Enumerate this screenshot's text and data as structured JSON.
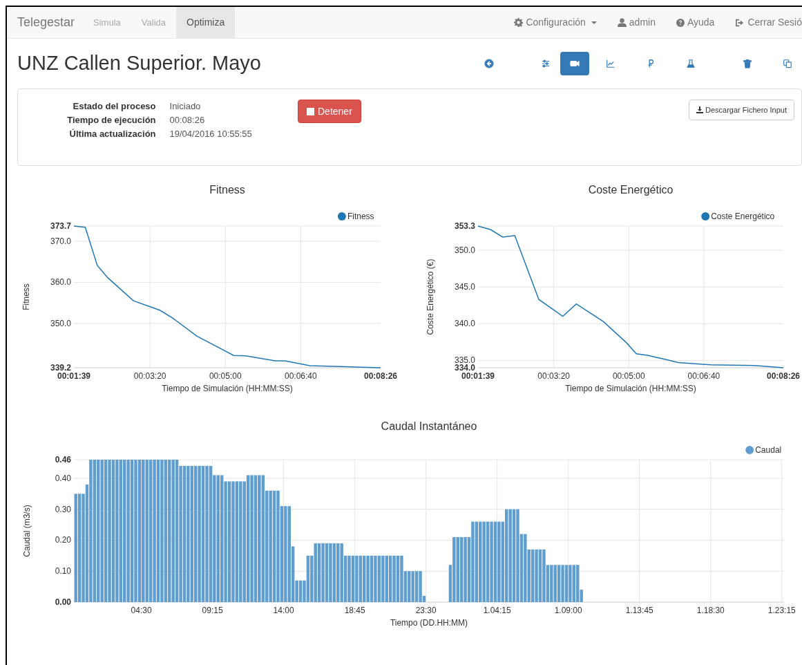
{
  "navbar": {
    "brand": "Telegestar",
    "tabs": [
      {
        "label": "Simula",
        "selected": false,
        "disabled": true
      },
      {
        "label": "Valida",
        "selected": false,
        "disabled": true
      },
      {
        "label": "Optimiza",
        "selected": true,
        "disabled": false
      }
    ],
    "menu": [
      {
        "kind": "gear",
        "label": "Configuración",
        "dropdown": true
      },
      {
        "kind": "user",
        "label": "admin",
        "dropdown": false
      },
      {
        "kind": "help",
        "label": "Ayuda",
        "dropdown": false
      },
      {
        "kind": "logout",
        "label": "Cerrar Sesió",
        "dropdown": false
      }
    ]
  },
  "page_title": "UNZ Callen Superior. Mayo",
  "toolbar": [
    {
      "kind": "back",
      "selected": false
    },
    {
      "kind": "sliders",
      "selected": false
    },
    {
      "kind": "camera",
      "selected": true
    },
    {
      "kind": "chart",
      "selected": false
    },
    {
      "kind": "currency",
      "selected": false
    },
    {
      "kind": "flask",
      "selected": false
    },
    {
      "kind": "trash",
      "selected": false
    },
    {
      "kind": "copy",
      "selected": false
    }
  ],
  "process_panel": {
    "fields": [
      {
        "label": "Estado del proceso",
        "value": "Iniciado"
      },
      {
        "label": "Tiempo de ejecución",
        "value": "00:08:26"
      },
      {
        "label": "Última actualización",
        "value": "19/04/2016 10:55:55"
      }
    ],
    "stop_button": "Detener",
    "download_button": "Descargar Fichero Input"
  },
  "fitness_chart": {
    "chart_data": {
      "type": "line",
      "grid": true,
      "title": "Fitness",
      "xlabel": "Tiempo de Simulación (HH:MM:SS)",
      "ylabel": "Fitness",
      "x": [
        99,
        114,
        130,
        144,
        178,
        213,
        230,
        262,
        311,
        327,
        366,
        379,
        412,
        506
      ],
      "series": [
        {
          "name": "Fitness",
          "color": "#1f77b4",
          "values": [
            373.7,
            373.4,
            364.1,
            361.1,
            355.5,
            353.2,
            351.3,
            346.9,
            342.2,
            342.1,
            340.9,
            340.9,
            339.7,
            339.2
          ]
        }
      ],
      "xlim": [
        99,
        506
      ],
      "ylim": [
        339.2,
        373.7
      ],
      "xticks": [
        {
          "value": 99,
          "label": "00:01:39"
        },
        {
          "value": 200,
          "label": "00:03:20"
        },
        {
          "value": 300,
          "label": "00:05:00"
        },
        {
          "value": 400,
          "label": "00:06:40"
        },
        {
          "value": 506,
          "label": "00:08:26"
        }
      ],
      "yticks": [
        {
          "value": 339.2,
          "label": "339.2"
        },
        {
          "value": 350,
          "label": "350.0"
        },
        {
          "value": 360,
          "label": "360.0"
        },
        {
          "value": 370,
          "label": "370.0"
        },
        {
          "value": 373.7,
          "label": "373.7"
        }
      ]
    }
  },
  "cost_chart": {
    "chart_data": {
      "type": "line",
      "grid": true,
      "title": "Coste Energético",
      "xlabel": "Tiempo de Simulación (HH:MM:SS)",
      "ylabel": "Coste Energético (€)",
      "x": [
        99,
        116,
        132,
        148,
        180,
        212,
        230,
        266,
        297,
        310,
        325,
        350,
        366,
        410,
        468,
        506
      ],
      "series": [
        {
          "name": "Coste Energético",
          "color": "#1f77b4",
          "values": [
            353.3,
            352.8,
            351.8,
            352.0,
            343.3,
            341.0,
            342.7,
            340.3,
            337.4,
            335.9,
            335.7,
            335.1,
            334.7,
            334.4,
            334.3,
            334.0
          ]
        }
      ],
      "xlim": [
        99,
        506
      ],
      "ylim": [
        334,
        353.3
      ],
      "xticks": [
        {
          "value": 99,
          "label": "00:01:39"
        },
        {
          "value": 200,
          "label": "00:03:20"
        },
        {
          "value": 300,
          "label": "00:05:00"
        },
        {
          "value": 400,
          "label": "00:06:40"
        },
        {
          "value": 506,
          "label": "00:08:26"
        }
      ],
      "yticks": [
        {
          "value": 334,
          "label": "334.0"
        },
        {
          "value": 335,
          "label": "335.0"
        },
        {
          "value": 340,
          "label": "340.0"
        },
        {
          "value": 345,
          "label": "345.0"
        },
        {
          "value": 350,
          "label": "350.0"
        },
        {
          "value": 353.3,
          "label": "353.3"
        }
      ]
    }
  },
  "flow_chart": {
    "chart_data": {
      "type": "bar",
      "grid": true,
      "title": "Caudal Instantáneo",
      "xlabel": "Tiempo (DD.HH:MM)",
      "ylabel": "Caudal (m3/s)",
      "x": [
        0,
        0.25,
        0.5,
        0.75,
        1,
        1.25,
        1.5,
        1.75,
        2,
        2.25,
        2.5,
        2.75,
        3,
        3.25,
        3.5,
        3.75,
        4,
        4.25,
        4.5,
        4.75,
        5,
        5.25,
        5.5,
        5.75,
        6,
        6.25,
        6.5,
        6.75,
        7,
        7.25,
        7.5,
        7.75,
        8,
        8.25,
        8.5,
        8.75,
        9,
        9.25,
        9.5,
        9.75,
        10,
        10.25,
        10.5,
        10.75,
        11,
        11.25,
        11.5,
        11.75,
        12,
        12.25,
        12.5,
        12.75,
        13,
        13.25,
        13.5,
        13.75,
        14,
        14.25,
        14.5,
        14.75,
        15,
        15.25,
        15.5,
        15.75,
        16,
        16.25,
        16.5,
        16.75,
        17,
        17.25,
        17.5,
        17.75,
        18,
        18.25,
        18.5,
        18.75,
        19,
        19.25,
        19.5,
        19.75,
        20,
        20.25,
        20.5,
        20.75,
        21,
        21.25,
        21.5,
        21.75,
        22,
        22.25,
        22.5,
        22.75,
        23,
        23.25,
        23.5,
        23.75,
        24,
        24.25,
        24.5,
        24.75,
        25,
        25.25,
        25.5,
        25.75,
        26,
        26.25,
        26.5,
        26.75,
        27,
        27.25,
        27.5,
        27.75,
        28,
        28.25,
        28.5,
        28.75,
        29,
        29.25,
        29.5,
        29.75,
        30,
        30.25,
        30.5,
        30.75,
        31,
        31.25,
        31.5,
        31.75,
        32,
        32.25,
        32.5,
        32.75,
        33,
        33.25,
        33.5,
        33.75
      ],
      "series": [
        {
          "name": "Caudal",
          "color": "#5f9ecf",
          "values": [
            0.35,
            0.35,
            0.35,
            0.38,
            0.46,
            0.46,
            0.46,
            0.46,
            0.46,
            0.46,
            0.46,
            0.46,
            0.46,
            0.46,
            0.46,
            0.46,
            0.46,
            0.46,
            0.46,
            0.46,
            0.46,
            0.46,
            0.46,
            0.46,
            0.46,
            0.46,
            0.46,
            0.46,
            0.44,
            0.44,
            0.44,
            0.44,
            0.44,
            0.44,
            0.44,
            0.44,
            0.44,
            0.41,
            0.41,
            0.41,
            0.39,
            0.39,
            0.39,
            0.39,
            0.39,
            0.39,
            0.41,
            0.41,
            0.41,
            0.41,
            0.41,
            0.36,
            0.36,
            0.36,
            0.36,
            0.31,
            0.31,
            0.31,
            0.18,
            0.07,
            0.07,
            0.07,
            0.15,
            0.15,
            0.19,
            0.19,
            0.19,
            0.19,
            0.19,
            0.19,
            0.19,
            0.19,
            0.15,
            0.15,
            0.15,
            0.15,
            0.15,
            0.15,
            0.15,
            0.15,
            0.15,
            0.15,
            0.15,
            0.15,
            0.15,
            0.15,
            0.15,
            0.15,
            0.1,
            0.1,
            0.1,
            0.1,
            0.1,
            0.02,
            null,
            null,
            null,
            null,
            null,
            null,
            0.12,
            0.21,
            0.21,
            0.21,
            0.21,
            0.21,
            0.26,
            0.26,
            0.26,
            0.26,
            0.26,
            0.26,
            0.26,
            0.26,
            0.26,
            0.3,
            0.3,
            0.3,
            0.3,
            0.22,
            0.22,
            0.17,
            0.17,
            0.17,
            0.17,
            0.17,
            0.12,
            0.12,
            0.12,
            0.12,
            0.12,
            0.12,
            0.12,
            0.12,
            0.12,
            0.04
          ]
        }
      ],
      "xlim": [
        0,
        47.4
      ],
      "ylim": [
        0,
        0.46
      ],
      "xticks": [
        {
          "value": 4.5,
          "label": "04:30"
        },
        {
          "value": 9.25,
          "label": "09:15"
        },
        {
          "value": 14,
          "label": "14:00"
        },
        {
          "value": 18.75,
          "label": "18:45"
        },
        {
          "value": 23.5,
          "label": "23:30"
        },
        {
          "value": 28.25,
          "label": "1.04:15"
        },
        {
          "value": 33,
          "label": "1.09:00"
        },
        {
          "value": 37.75,
          "label": "1.13:45"
        },
        {
          "value": 42.5,
          "label": "1.18:30"
        },
        {
          "value": 47.25,
          "label": "1.23:15"
        }
      ],
      "yticks": [
        {
          "value": 0,
          "label": "0.00"
        },
        {
          "value": 0.1,
          "label": "0.10"
        },
        {
          "value": 0.2,
          "label": "0.20"
        },
        {
          "value": 0.3,
          "label": "0.30"
        },
        {
          "value": 0.4,
          "label": "0.40"
        },
        {
          "value": 0.46,
          "label": "0.46"
        }
      ]
    }
  }
}
